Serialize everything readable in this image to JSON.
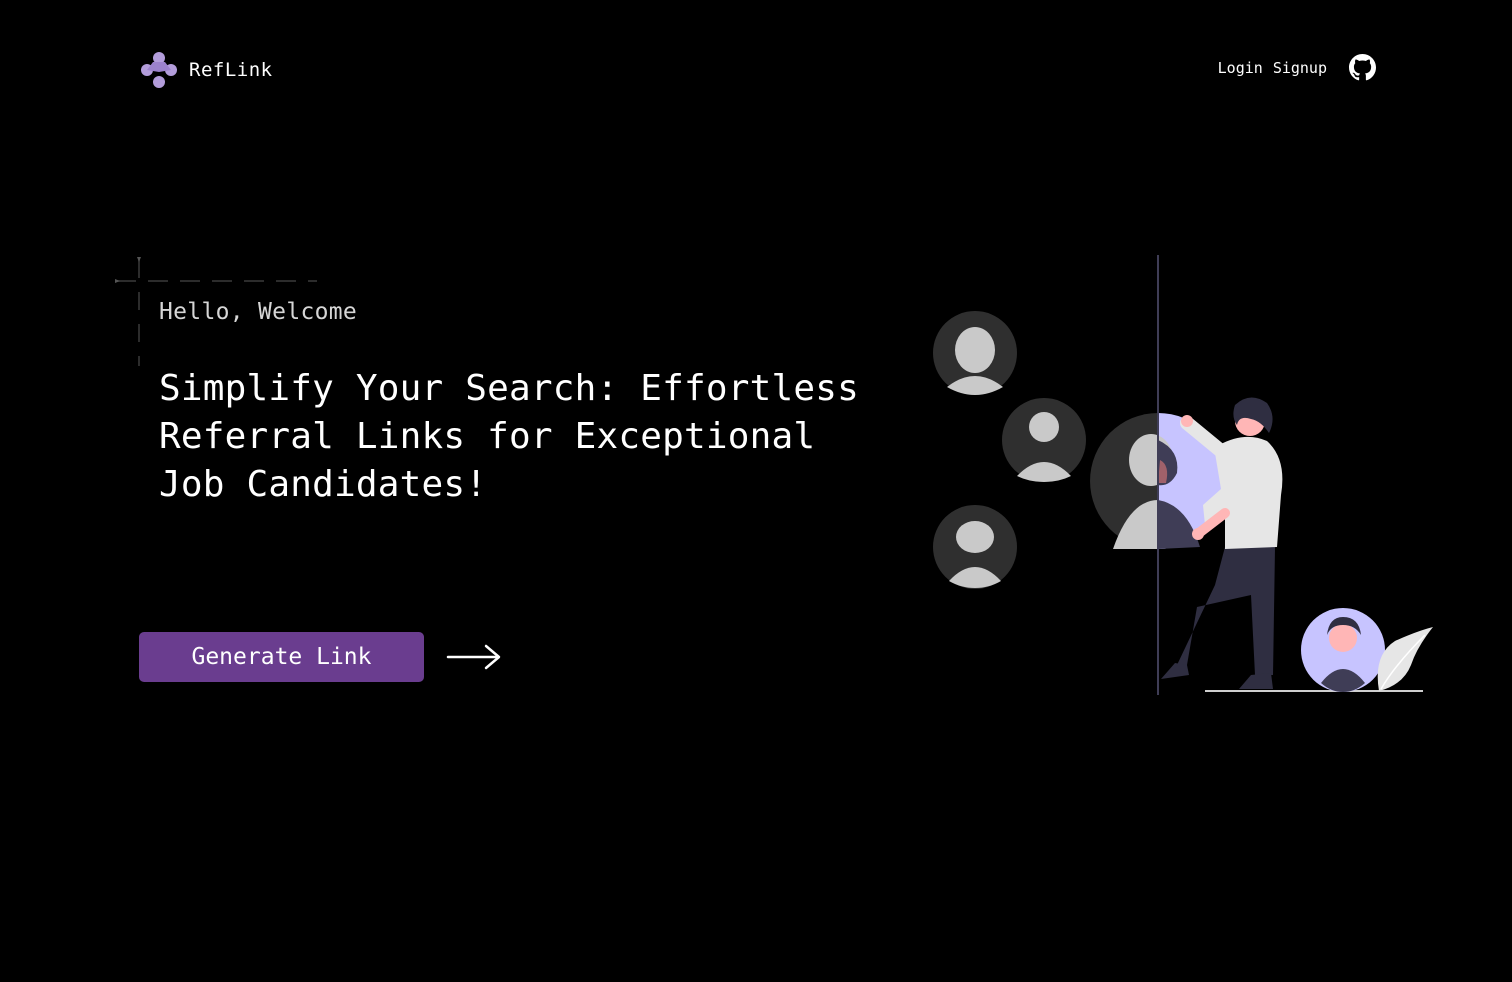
{
  "brand": {
    "name": "RefLink",
    "logo_icon": "reflink-logo-icon",
    "accent_color": "#b39ddb"
  },
  "nav": {
    "login_label": "Login",
    "signup_label": "Signup",
    "github_icon": "github-icon"
  },
  "hero": {
    "greeting": "Hello, Welcome",
    "headline": "Simplify Your Search: Effortless Referral Links for Exceptional Job Candidates!",
    "cta_label": "Generate Link",
    "cta_color": "#6a3d8f",
    "arrow_icon": "arrow-right-icon"
  },
  "illustration": {
    "name": "person-connecting-profiles-illustration",
    "primary_color": "#c7c4ff",
    "avatar_bg": "#2f2f2f"
  }
}
